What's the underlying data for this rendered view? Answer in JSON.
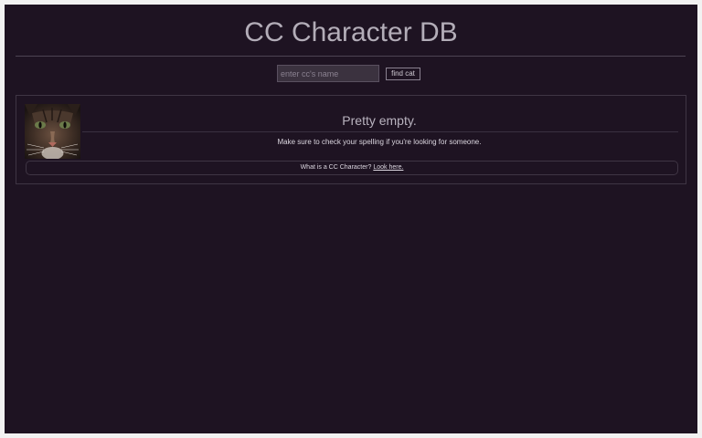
{
  "header": {
    "title": "CC Character DB"
  },
  "search": {
    "placeholder": "enter cc's name",
    "value": "",
    "button_label": "find cat"
  },
  "result": {
    "heading": "Pretty empty.",
    "message": "Make sure to check your spelling if you're looking for someone.",
    "info_text": "What is a CC Character?",
    "info_link_label": "Look here."
  },
  "colors": {
    "page_background": "#1e1322",
    "title_text": "#b3adb8",
    "border": "#3f3544"
  }
}
